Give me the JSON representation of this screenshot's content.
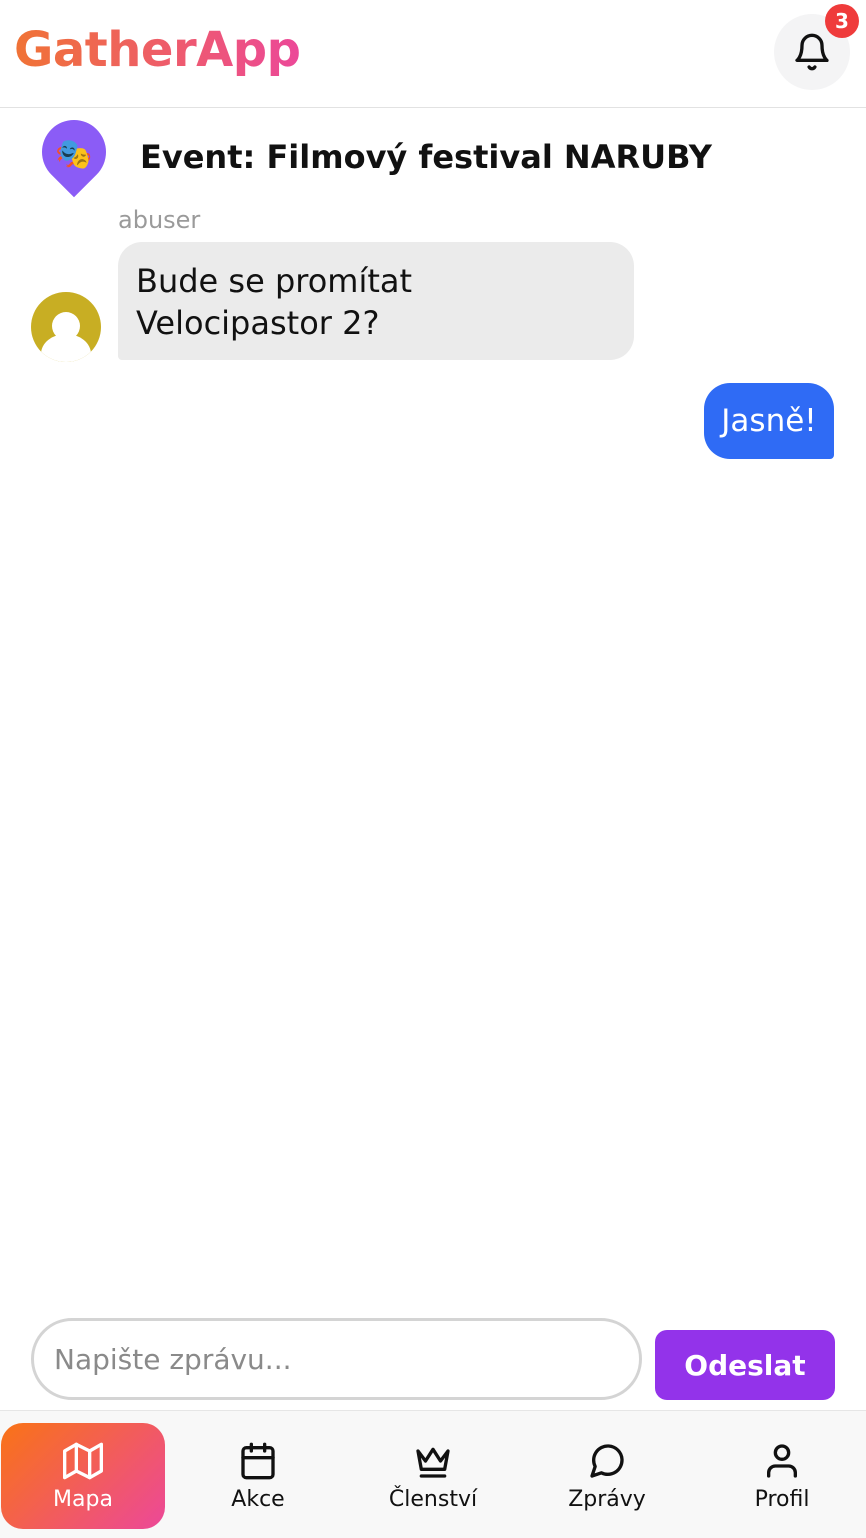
{
  "app": {
    "name": "GatherApp"
  },
  "header": {
    "notification_count": "3"
  },
  "event": {
    "title": "Event: Filmový festival NARUBY",
    "icon": "🎭"
  },
  "messages": [
    {
      "sender": "abuser",
      "text": "Bude se promítat Velocipastor 2?",
      "direction": "incoming"
    },
    {
      "text": "Jasně!",
      "direction": "outgoing"
    }
  ],
  "composer": {
    "placeholder": "Napište zprávu...",
    "value": "",
    "send_label": "Odeslat"
  },
  "nav": {
    "items": [
      {
        "label": "Mapa",
        "icon": "map-icon",
        "active": true
      },
      {
        "label": "Akce",
        "icon": "calendar-icon"
      },
      {
        "label": "Členství",
        "icon": "crown-icon"
      },
      {
        "label": "Zprávy",
        "icon": "chat-icon"
      },
      {
        "label": "Profil",
        "icon": "user-icon"
      }
    ]
  },
  "colors": {
    "brand_start": "#f07335",
    "brand_end": "#ec4899",
    "outgoing_bubble": "#2f6bf5",
    "incoming_bubble": "#ebebeb",
    "send_button": "#9333ea",
    "badge": "#ef3b3b",
    "event_pin": "#8b5cf6"
  }
}
